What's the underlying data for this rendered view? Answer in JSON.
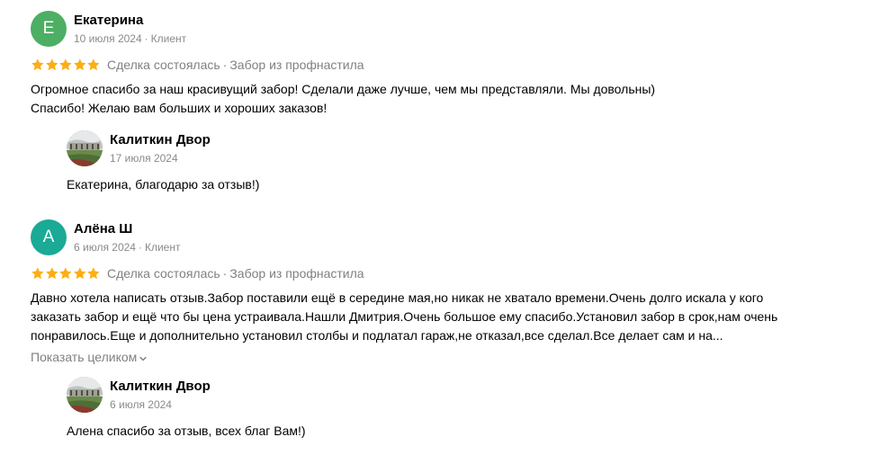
{
  "reviews": [
    {
      "author": "Екатерина",
      "initial": "Е",
      "avatar_color": "#4caf63",
      "date": "10 июля 2024",
      "role": "Клиент",
      "stars": 5,
      "deal_status": "Сделка состоялась",
      "service": "Забор из профнастила",
      "text_lines": [
        "Огромное спасибо за наш красивущий забор! Сделали даже лучше, чем мы представляли. Мы довольны)",
        "Спасибо! Желаю вам больших и хороших заказов!"
      ],
      "reply": {
        "business_name": "Калиткин Двор",
        "date": "17 июля 2024",
        "text": "Екатерина, благодарю за отзыв!)"
      }
    },
    {
      "author": "Алёна Ш",
      "initial": "А",
      "avatar_color": "#1aaa96",
      "date": "6 июля 2024",
      "role": "Клиент",
      "stars": 5,
      "deal_status": "Сделка состоялась",
      "service": "Забор из профнастила",
      "text_lines": [
        "Давно хотела написать отзыв.Забор поставили ещё в середине мая,но никак не хватало времени.Очень долго искала у кого",
        "заказать забор и ещё что бы цена устраивала.Нашли Дмитрия.Очень большое ему спасибо.Установил забор в срок,нам очень",
        "понравилось.Еще и дополнительно установил столбы и подлатал гараж,не отказал,все сделал.Все делает сам и на..."
      ],
      "show_more_label": "Показать целиком",
      "reply": {
        "business_name": "Калиткин Двор",
        "date": "6 июля 2024",
        "text": "Алена спасибо за отзыв, всех благ Вам!)"
      }
    }
  ],
  "separator": "·",
  "colors": {
    "star": "#fcae15",
    "meta_text": "#8a8a8a"
  },
  "icons": {
    "star": "star-icon",
    "chevron": "chevron-down-icon"
  }
}
